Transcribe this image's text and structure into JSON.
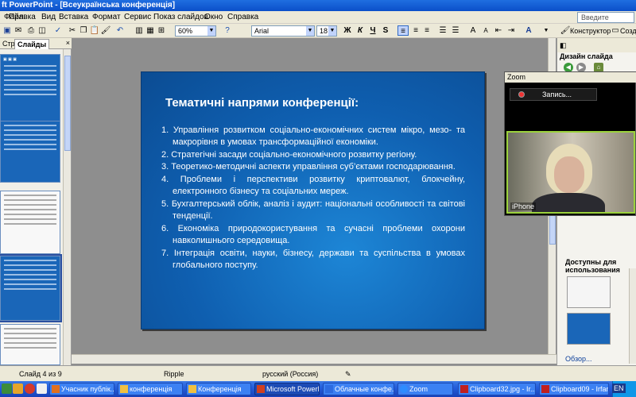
{
  "window": {
    "title": "ft PowerPoint - [Всеукраїнська конференція]"
  },
  "menu": {
    "items": [
      "Файл",
      "Правка",
      "Вид",
      "Вставка",
      "Формат",
      "Сервис",
      "Показ слайдов",
      "Окно",
      "Справка"
    ],
    "help_placeholder": "Введите вопрос"
  },
  "toolbar": {
    "zoom": "60%",
    "font": "Arial",
    "size": "18",
    "bold": "Ж",
    "italic": "К",
    "underline": "Ч",
    "shadow": "S",
    "constructor": "Конструктор",
    "create": "Создать"
  },
  "left_pane": {
    "tab_outline": "Структура",
    "tab_slides": "Слайды",
    "close": "×"
  },
  "slide": {
    "title": "Тематичні напрями конференції:",
    "items": [
      "1. Управління розвитком соціально-економічних систем мікро, мезо- та макрорівня в умовах трансформаційної економіки.",
      "2.  Стратегічні засади соціально-економічного розвитку регіону.",
      "3.  Теоретико-методичні аспекти управління суб’єктами господарювання.",
      "4. Проблеми і перспективи розвитку криптовалют, блокчейну, електронного бізнесу та соціальних мереж.",
      "5.  Бухгалтерський облік, аналіз і аудит: національні особливості та світові тенденції.",
      "6.  Економіка природокористування та сучасні проблеми охорони навколишнього середовища.",
      "7. Інтеграція освіти, науки, бізнесу, держави та суспільства в умовах глобального поступу."
    ]
  },
  "right_pane": {
    "title": "Дизайн слайда",
    "section": "Доступны для использования",
    "link": "Обзор..."
  },
  "zoom": {
    "title": "Zoom",
    "record": "Запись...",
    "participant": "iPhone"
  },
  "status": {
    "slide": "Слайд 4 из 9",
    "design": "Ripple",
    "language": "русский (Россия)"
  },
  "taskbar": {
    "tasks": [
      "Учасник публік...",
      "конференція",
      "Конференція",
      "Microsoft PowerP...",
      "Облачные конфе...",
      "Zoom",
      "Clipboard32.jpg - Ir...",
      "Clipboard09 - Irfan..."
    ],
    "lang": "EN"
  },
  "colors": {
    "slide_blue": "#0f5fb0",
    "xp_taskbar": "#245edb",
    "zoom_highlight": "#9bd23c"
  }
}
